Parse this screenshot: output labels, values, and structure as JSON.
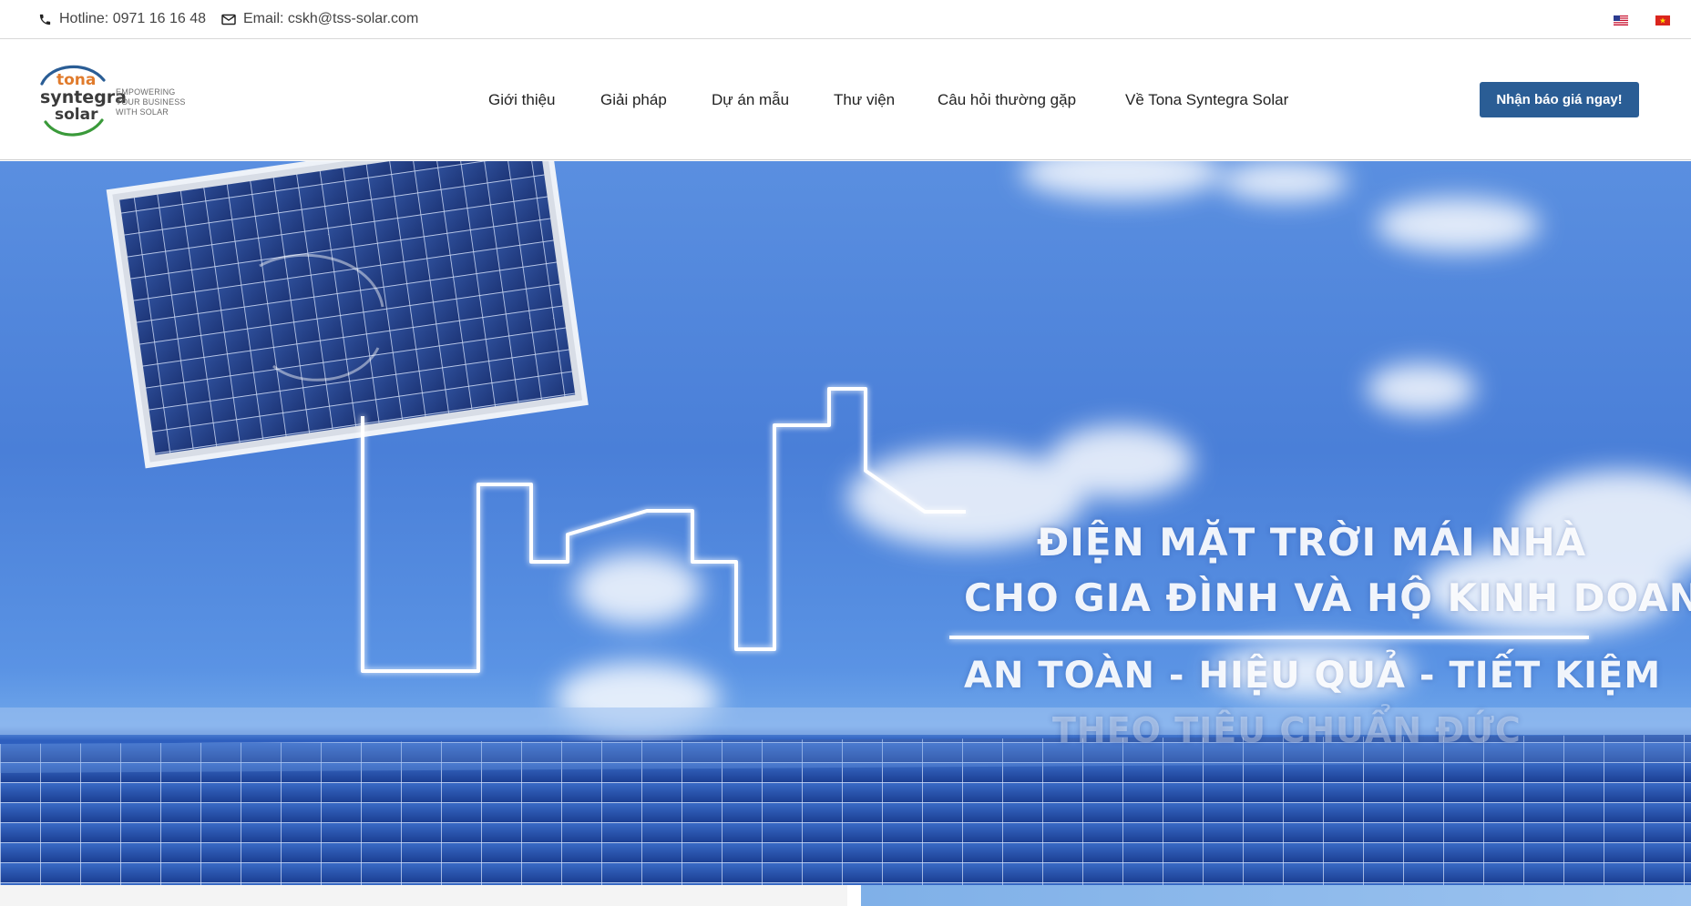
{
  "topbar": {
    "hotline": "Hotline: 0971 16 16 48",
    "email": "Email: cskh@tss-solar.com",
    "languages": [
      "English",
      "Tiếng Việt"
    ]
  },
  "brand": {
    "word1": "tona",
    "word2": "syntegra",
    "word3": "solar",
    "tagline": [
      "EMPOWERING",
      "YOUR BUSINESS",
      "WITH SOLAR"
    ],
    "colors": {
      "orange": "#e07b2c",
      "blue": "#2a5d95",
      "green": "#3a9a3a"
    }
  },
  "nav": {
    "items": [
      {
        "label": "Giới thiệu"
      },
      {
        "label": "Giải pháp"
      },
      {
        "label": "Dự án mẫu"
      },
      {
        "label": "Thư viện"
      },
      {
        "label": "Câu hỏi thường gặp"
      },
      {
        "label": "Về Tona Syntegra Solar"
      }
    ],
    "cta_label": "Nhận báo giá ngay!",
    "cta_color": "#2a5d95"
  },
  "hero": {
    "line1": "ĐIỆN MẶT TRỜI MÁI NHÀ",
    "line2": "CHO GIA ĐÌNH VÀ HỘ KINH DOANH",
    "line3": "AN TOÀN - HIỆU QUẢ - TIẾT KIỆM",
    "line4": "THEO TIÊU CHUẨN ĐỨC"
  }
}
